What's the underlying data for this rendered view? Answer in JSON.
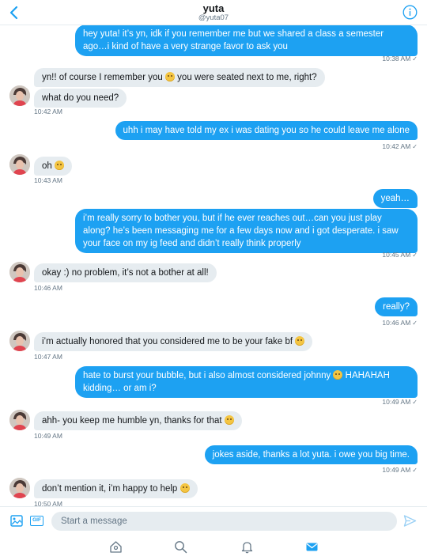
{
  "header": {
    "name": "yuta",
    "handle": "@yuta07"
  },
  "colors": {
    "accent": "#1da1f2",
    "incoming_bubble": "#e6ecf0",
    "muted_text": "#657786"
  },
  "icons": {
    "back": "chevron-left-icon",
    "info": "info-icon",
    "media": "image-icon",
    "gif": "gif-icon",
    "send": "send-icon",
    "tabs": [
      "home-icon",
      "search-icon",
      "notifications-icon",
      "messages-icon"
    ]
  },
  "messages": [
    {
      "dir": "out",
      "text": "hey yuta! it’s yn, idk if you remember me but we shared a class a semester ago…i kind of have a very strange favor to ask you",
      "time": "10:38 AM",
      "read": true
    },
    {
      "dir": "in",
      "text": "yn!! of course I remember you",
      "text_after": "you were seated next to me, right?",
      "emoji": "relieved-face-emoji"
    },
    {
      "dir": "in",
      "text": "what do you need?",
      "time": "10:42 AM"
    },
    {
      "dir": "out",
      "text": "uhh i may have told my ex i was dating you so he could leave me alone",
      "time": "10:42 AM",
      "read": true
    },
    {
      "dir": "in",
      "text": "oh",
      "emoji": "flushed-face-emoji",
      "time": "10:43 AM"
    },
    {
      "dir": "out",
      "text": "yeah…"
    },
    {
      "dir": "out",
      "text": "i’m really sorry to bother you, but if he ever reaches out…can you just play along? he’s been messaging me for a few days now and i got desperate. i saw your face on my ig feed and didn’t really think properly",
      "time": "10:45 AM",
      "read": true
    },
    {
      "dir": "in",
      "text": "okay :) no problem, it’s not a bother at all!",
      "time": "10:46 AM"
    },
    {
      "dir": "out",
      "text": "really?",
      "time": "10:46 AM",
      "read": true
    },
    {
      "dir": "in",
      "text": "i’m actually honored that you considered me to be your fake bf",
      "emoji": "winking-face-emoji",
      "time": "10:47 AM"
    },
    {
      "dir": "out",
      "text": "hate to burst your bubble, but i also almost considered johnny",
      "text_after": "HAHAHAH kidding… or am i?",
      "emoji": "grinning-sweat-emoji",
      "time": "10:49 AM",
      "read": true
    },
    {
      "dir": "in",
      "text": "ahh- you keep me humble yn, thanks for that",
      "emoji": "grimacing-face-emoji",
      "time": "10:49 AM"
    },
    {
      "dir": "out",
      "text": "jokes aside, thanks a lot yuta. i owe you big time.",
      "time": "10:49 AM",
      "read": true
    },
    {
      "dir": "in",
      "text": "don’t mention it, i’m happy to help",
      "emoji": "relieved-face-emoji",
      "time": "10:50 AM"
    }
  ],
  "composer": {
    "gif_label": "GIF",
    "placeholder": "Start a message"
  },
  "check_mark": "✓"
}
